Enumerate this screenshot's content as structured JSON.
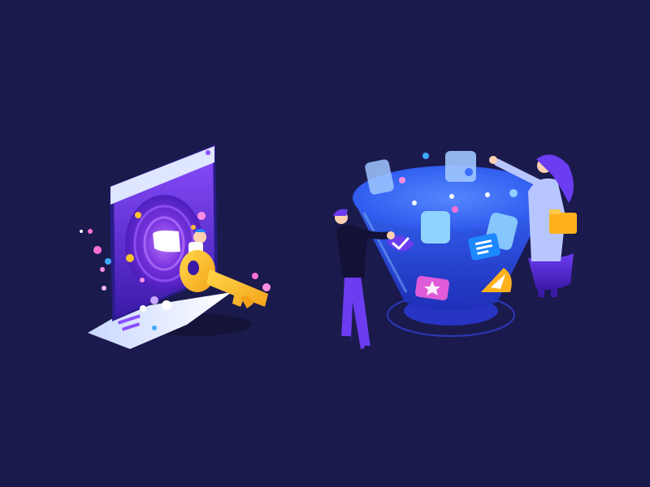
{
  "scene": {
    "background": "#1b1a4d",
    "palette": {
      "screen_top": "#7c4dff",
      "screen_bottom": "#3d1fb3",
      "key_gold": "#ffc22e",
      "funnel_glow": "#3a6dff",
      "card_light": "#8fd3ff",
      "accent_pink": "#ff6fd8",
      "accent_orange": "#ffb21e"
    },
    "left_group": {
      "objects": [
        "phone-screen",
        "door-opening",
        "person-icon",
        "golden-key",
        "particles"
      ]
    },
    "right_group": {
      "objects": [
        "glass-funnel",
        "man-figure",
        "woman-figure",
        "floating-cards",
        "check-badge",
        "doc-badge",
        "star-badge",
        "send-badge",
        "orange-folder"
      ]
    }
  }
}
